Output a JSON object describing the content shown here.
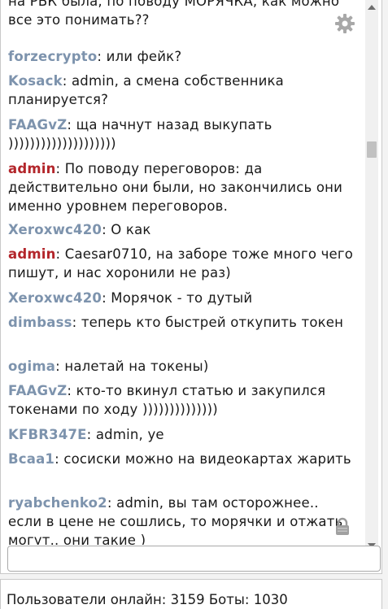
{
  "messages": [
    {
      "nick": "",
      "text": "на РБК была, по поводу МОРЯЧКА, как можно все это понимать??",
      "role": "user"
    },
    {
      "nick": "forzecrypto",
      "text": ": или фейк?",
      "role": "user"
    },
    {
      "nick": "Kosack",
      "text": ": admin, а смена собственника планируется?",
      "role": "user"
    },
    {
      "nick": "FAAGvZ",
      "text": ": ща начнут назад выкупать ))))))))))))))))))))",
      "role": "user"
    },
    {
      "nick": "admin",
      "text": ": По поводу переговоров: да действительно они были, но закончились они именно уровнем переговоров.",
      "role": "admin"
    },
    {
      "nick": "Xeroxwc420",
      "text": ": О как",
      "role": "user"
    },
    {
      "nick": "admin",
      "text": ": Caesar0710, на заборе тоже много чего пишут, и нас хоронили не раз)",
      "role": "admin"
    },
    {
      "nick": "Xeroxwc420",
      "text": ": Морячок - то дутый",
      "role": "user"
    },
    {
      "nick": "dimbass",
      "text": ": теперь кто быстрей откупить токен",
      "role": "user"
    },
    {
      "nick": "ogima",
      "text": ": налетай на токены)",
      "role": "user"
    },
    {
      "nick": "FAAGvZ",
      "text": ": кто-то вкинул статью и закупился токенами по ходу ))))))))))))))",
      "role": "user"
    },
    {
      "nick": "KFBR347E",
      "text": ": admin, уе",
      "role": "user"
    },
    {
      "nick": "Bcaa1",
      "text": ": сосиски можно на видеокартах жарить",
      "role": "user"
    },
    {
      "nick": "ryabchenko2",
      "text": ": admin, вы там осторожнее.. если в цене не сошлись, то морячки и отжать могут.. они такие )",
      "role": "user"
    }
  ],
  "chat_input": {
    "value": "",
    "placeholder": ""
  },
  "status": {
    "text": "Пользователи онлайн: 3159 Боты: 1030"
  },
  "icons": {
    "settings": "gear-icon",
    "lock": "lock-icon"
  },
  "colors": {
    "nick": "#7d93ad",
    "admin_nick": "#b3262b"
  }
}
